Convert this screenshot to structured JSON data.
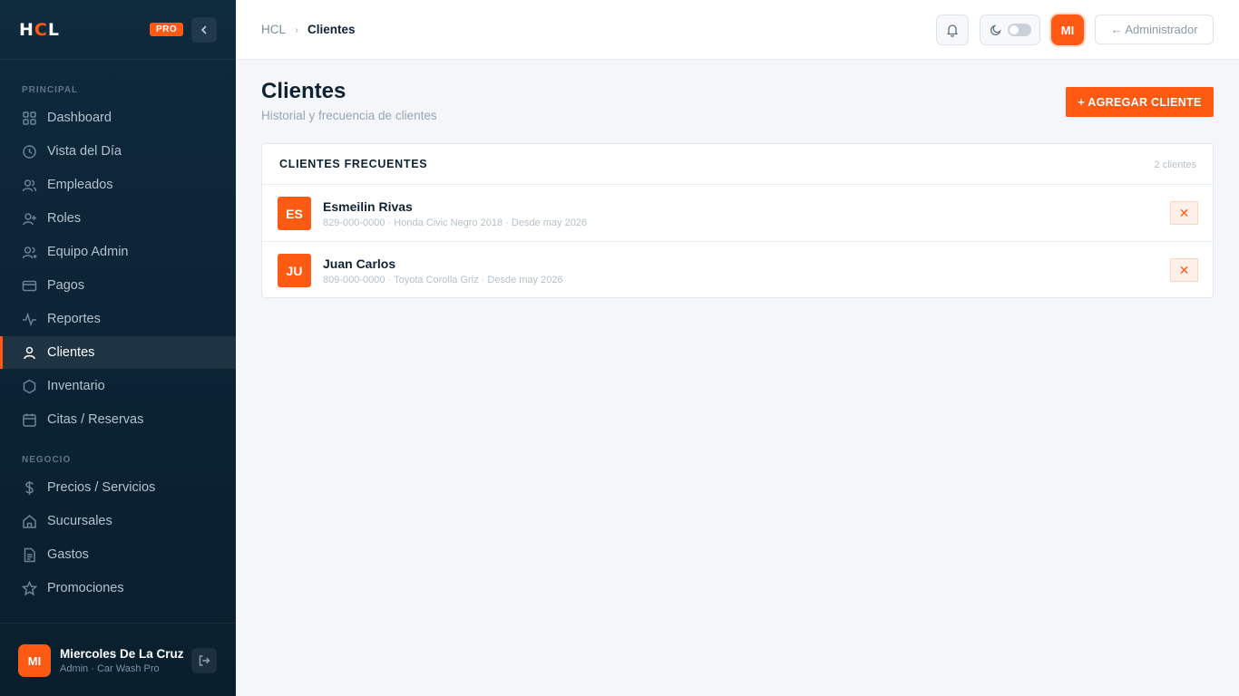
{
  "sidebar": {
    "logo_prefix": "H",
    "logo_accent": "C",
    "logo_suffix": "L",
    "badge": "PRO",
    "sections": {
      "principal": "PRINCIPAL",
      "negocio": "NEGOCIO"
    },
    "items": [
      {
        "label": "Dashboard",
        "icon": "grid-icon"
      },
      {
        "label": "Vista del Día",
        "icon": "clock-icon"
      },
      {
        "label": "Empleados",
        "icon": "users-icon"
      },
      {
        "label": "Roles",
        "icon": "user-plus-icon"
      },
      {
        "label": "Equipo Admin",
        "icon": "user-team-icon"
      },
      {
        "label": "Pagos",
        "icon": "credit-card-icon"
      },
      {
        "label": "Reportes",
        "icon": "activity-icon"
      },
      {
        "label": "Clientes",
        "icon": "user-icon",
        "active": true
      },
      {
        "label": "Inventario",
        "icon": "hexagon-icon"
      },
      {
        "label": "Citas / Reservas",
        "icon": "calendar-icon"
      },
      {
        "label": "Precios / Servicios",
        "icon": "dollar-icon"
      },
      {
        "label": "Sucursales",
        "icon": "store-icon"
      },
      {
        "label": "Gastos",
        "icon": "document-icon"
      },
      {
        "label": "Promociones",
        "icon": "star-icon"
      }
    ],
    "user": {
      "initials": "MI",
      "name": "Miercoles De La Cruz",
      "role": "Admin · Car Wash Pro"
    }
  },
  "topbar": {
    "breadcrumb_root": "HCL",
    "breadcrumb_current": "Clientes",
    "avatar_initials": "MI",
    "admin_button": "← Administrador"
  },
  "main": {
    "title": "Clientes",
    "subtitle": "Historial y frecuencia de clientes",
    "add_button": "+ AGREGAR CLIENTE",
    "card": {
      "title": "CLIENTES FRECUENTES",
      "count": "2 clientes",
      "rows": [
        {
          "initials": "ES",
          "name": "Esmeilin Rivas",
          "meta": "829-000-0000 · Honda Civic Negro 2018 · Desde may 2026",
          "delete": "✕"
        },
        {
          "initials": "JU",
          "name": "Juan Carlos",
          "meta": "809-000-0000 · Toyota Corolla Griz · Desde may 2026",
          "delete": "✕"
        }
      ]
    }
  },
  "colors": {
    "accent": "#ff5a14",
    "sidebar_bg": "#0b2233",
    "page_bg": "#f4f6f9"
  }
}
